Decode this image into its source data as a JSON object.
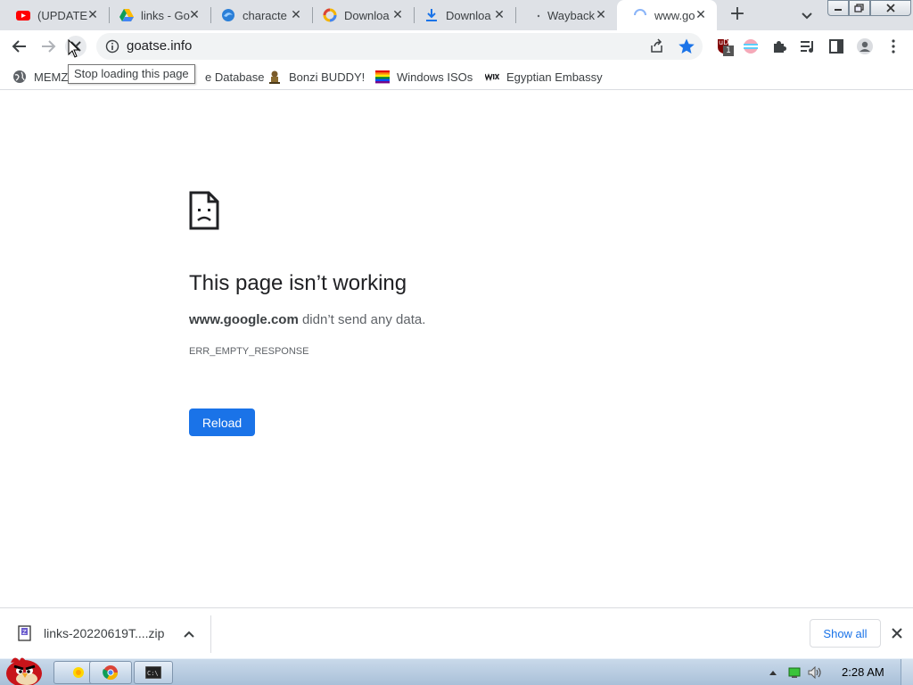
{
  "tabs": [
    {
      "title": "(UPDATE",
      "icon": "youtube-icon"
    },
    {
      "title": "links - Go",
      "icon": "google-drive-icon"
    },
    {
      "title": "characte",
      "icon": "edge-swirl-icon"
    },
    {
      "title": "Downloa",
      "icon": "rainbow-ring-icon"
    },
    {
      "title": "Downloa",
      "icon": "download-arrow-icon"
    },
    {
      "title": "Wayback",
      "icon": "wayback-icon"
    },
    {
      "title": "www.go",
      "icon": "loading-spinner-icon",
      "active": true
    }
  ],
  "omnibox": {
    "url": "goatse.info"
  },
  "tooltip": {
    "text": "Stop loading this page"
  },
  "bookmarks": [
    {
      "label": "MEMZ",
      "icon": "globe-icon"
    },
    {
      "label": "e Database",
      "icon": ""
    },
    {
      "label": "Bonzi BUDDY!",
      "icon": "bonzi-icon"
    },
    {
      "label": "Windows ISOs",
      "icon": "rainbow-flag-icon"
    },
    {
      "label": "Egyptian Embassy",
      "icon": "wix-icon"
    }
  ],
  "error": {
    "title": "This page isn’t working",
    "host": "www.google.com",
    "desc": " didn’t send any data.",
    "code": "ERR_EMPTY_RESPONSE",
    "reload_label": "Reload"
  },
  "download": {
    "filename": "links-20220619T....zip",
    "show_all_label": "Show all"
  },
  "taskbar": {
    "clock": "2:28 AM",
    "extension_badge": "1",
    "ublock_label": "uD"
  },
  "colors": {
    "accent": "#1a73e8",
    "tabstrip": "#dee1e6",
    "star": "#1a73e8"
  }
}
